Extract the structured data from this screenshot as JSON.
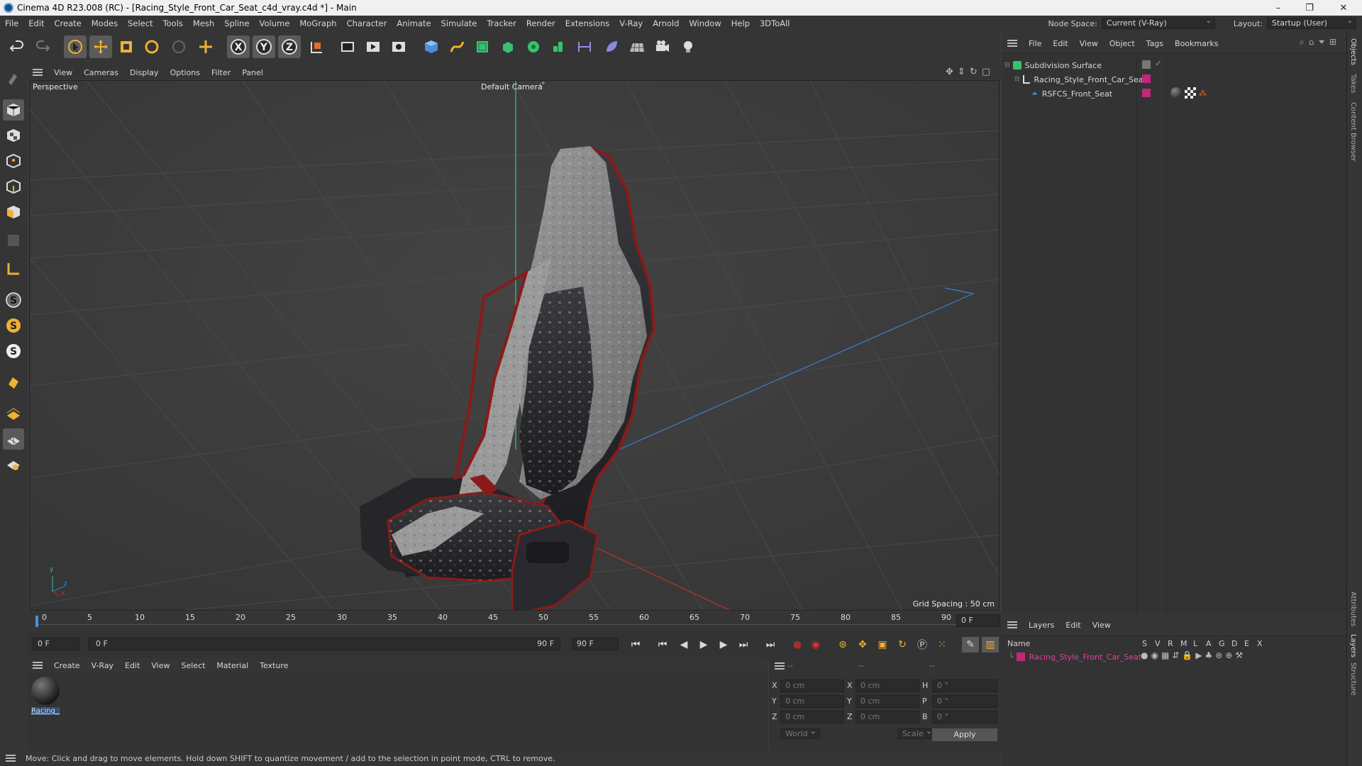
{
  "window": {
    "title": "Cinema 4D R23.008 (RC) - [Racing_Style_Front_Car_Seat_c4d_vray.c4d *] - Main",
    "controls": [
      "–",
      "❐",
      "✕"
    ]
  },
  "menubar": {
    "items": [
      "File",
      "Edit",
      "Create",
      "Modes",
      "Select",
      "Tools",
      "Mesh",
      "Spline",
      "Volume",
      "MoGraph",
      "Character",
      "Animate",
      "Simulate",
      "Tracker",
      "Render",
      "Extensions",
      "V-Ray",
      "Arnold",
      "Window",
      "Help",
      "3DToAll"
    ],
    "node_space_label": "Node Space:",
    "node_space_value": "Current (V-Ray)",
    "layout_label": "Layout:",
    "layout_value": "Startup (User)"
  },
  "viewport": {
    "menu": [
      "View",
      "Cameras",
      "Display",
      "Options",
      "Filter",
      "Panel"
    ],
    "view_name": "Perspective",
    "camera_name": "Default Camera",
    "camera_marker": ":°",
    "grid_spacing": "Grid Spacing : 50 cm",
    "axis_y": "y",
    "axis_z": "z",
    "axis_x": "x"
  },
  "timeline": {
    "ticks": [
      "0",
      "5",
      "10",
      "15",
      "20",
      "25",
      "30",
      "35",
      "40",
      "45",
      "50",
      "55",
      "60",
      "65",
      "70",
      "75",
      "80",
      "85",
      "90"
    ],
    "current_frame_field": "0 F",
    "start_field": "0 F",
    "range_start": "0 F",
    "range_end": "90 F",
    "end_field": "90 F"
  },
  "material_manager": {
    "menu": [
      "Create",
      "V-Ray",
      "Edit",
      "View",
      "Select",
      "Material",
      "Texture"
    ],
    "materials": [
      {
        "label": "Racing_S"
      }
    ]
  },
  "coordinates": {
    "headers": [
      "--",
      "--",
      "--"
    ],
    "rows": [
      {
        "a": "X",
        "av": "0 cm",
        "b": "X",
        "bv": "0 cm",
        "c": "H",
        "cv": "0 °"
      },
      {
        "a": "Y",
        "av": "0 cm",
        "b": "Y",
        "bv": "0 cm",
        "c": "P",
        "cv": "0 °"
      },
      {
        "a": "Z",
        "av": "0 cm",
        "b": "Z",
        "bv": "0 cm",
        "c": "B",
        "cv": "0 °"
      }
    ],
    "world": "World",
    "scale": "Scale",
    "apply": "Apply"
  },
  "status": "Move: Click and drag to move elements. Hold down SHIFT to quantize movement / add to the selection in point mode, CTRL to remove.",
  "object_manager": {
    "menu": [
      "File",
      "Edit",
      "View",
      "Object",
      "Tags",
      "Bookmarks"
    ],
    "objects": [
      {
        "name": "Subdivision Surface"
      },
      {
        "name": "Racing_Style_Front_Car_Seat"
      },
      {
        "name": "RSFCS_Front_Seat"
      }
    ]
  },
  "layer_manager": {
    "menu": [
      "Layers",
      "Edit",
      "View"
    ],
    "name_header": "Name",
    "columns": [
      "S",
      "V",
      "R",
      "M",
      "L",
      "A",
      "G",
      "D",
      "E",
      "X"
    ],
    "layers": [
      {
        "name": "Racing_Style_Front_Car_Seat",
        "color": "#c0287a"
      }
    ]
  },
  "side_tabs": [
    "Objects",
    "Takes",
    "Content Browser",
    "Attributes",
    "Layers",
    "Structure"
  ],
  "colors": {
    "accent": "#4a8fd8",
    "layer_text": "#e0409a",
    "tag_magenta": "#c0287a"
  }
}
